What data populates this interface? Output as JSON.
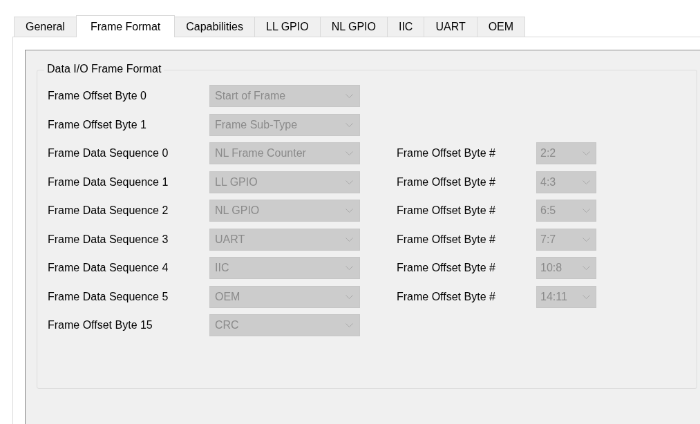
{
  "tabs": [
    {
      "label": "General",
      "selected": false
    },
    {
      "label": "Frame Format",
      "selected": true
    },
    {
      "label": "Capabilities",
      "selected": false
    },
    {
      "label": "LL GPIO",
      "selected": false
    },
    {
      "label": "NL GPIO",
      "selected": false
    },
    {
      "label": "IIC",
      "selected": false
    },
    {
      "label": "UART",
      "selected": false
    },
    {
      "label": "OEM",
      "selected": false
    }
  ],
  "group": {
    "title": "Data I/O Frame Format",
    "rows": [
      {
        "label": "Frame Offset Byte 0",
        "value": "Start of Frame",
        "disabled": true
      },
      {
        "label": "Frame Offset Byte 1",
        "value": "Frame Sub-Type",
        "disabled": true
      },
      {
        "label": "Frame Data Sequence 0",
        "value": "NL Frame Counter",
        "disabled": true,
        "offset": {
          "label": "Frame Offset Byte #",
          "value": "2:2",
          "disabled": true
        }
      },
      {
        "label": "Frame Data Sequence 1",
        "value": "LL GPIO",
        "disabled": true,
        "offset": {
          "label": "Frame Offset Byte #",
          "value": "4:3",
          "disabled": true
        }
      },
      {
        "label": "Frame Data Sequence 2",
        "value": "NL GPIO",
        "disabled": true,
        "offset": {
          "label": "Frame Offset Byte #",
          "value": "6:5",
          "disabled": true
        }
      },
      {
        "label": "Frame Data Sequence 3",
        "value": "UART",
        "disabled": true,
        "offset": {
          "label": "Frame Offset Byte #",
          "value": "7:7",
          "disabled": true
        }
      },
      {
        "label": "Frame Data Sequence 4",
        "value": "IIC",
        "disabled": true,
        "offset": {
          "label": "Frame Offset Byte #",
          "value": "10:8",
          "disabled": true
        }
      },
      {
        "label": "Frame Data Sequence 5",
        "value": "OEM",
        "disabled": true,
        "offset": {
          "label": "Frame Offset Byte #",
          "value": "14:11",
          "disabled": true
        }
      },
      {
        "label": "Frame Offset Byte 15",
        "value": "CRC",
        "disabled": true
      }
    ]
  }
}
